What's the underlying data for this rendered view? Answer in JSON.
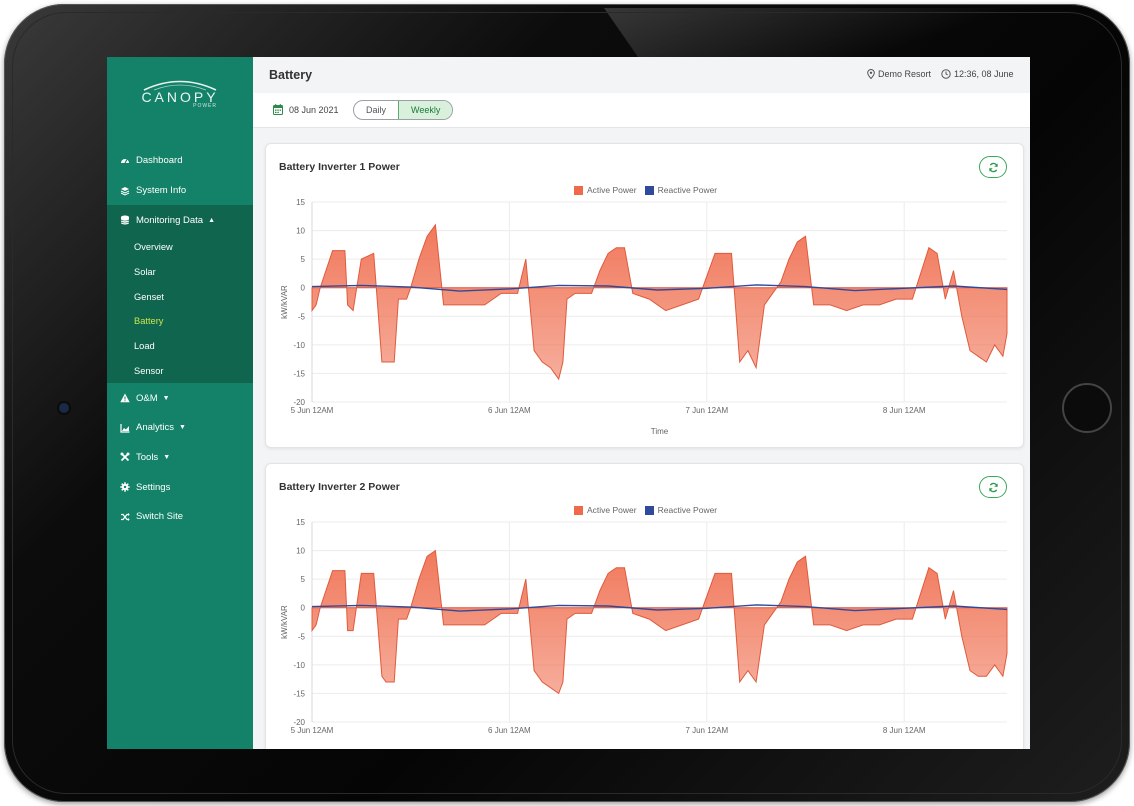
{
  "app": {
    "logo_text": "CANOPY",
    "logo_sub": "POWER",
    "page_title": "Battery",
    "site_name": "Demo Resort",
    "clock": "12:36, 08 June"
  },
  "sidebar": {
    "items": [
      {
        "label": "Dashboard",
        "icon": "gauge-icon"
      },
      {
        "label": "System Info",
        "icon": "layers-icon"
      },
      {
        "label": "Monitoring Data",
        "icon": "database-icon"
      },
      {
        "label": "O&M",
        "icon": "warning-icon"
      },
      {
        "label": "Analytics",
        "icon": "area-chart-icon"
      },
      {
        "label": "Tools",
        "icon": "tools-icon"
      },
      {
        "label": "Settings",
        "icon": "gear-icon"
      },
      {
        "label": "Switch Site",
        "icon": "shuffle-icon"
      }
    ],
    "monitoring_sub": [
      "Overview",
      "Solar",
      "Genset",
      "Battery",
      "Load",
      "Sensor"
    ],
    "active_sub": "Battery"
  },
  "filters": {
    "date": "08 Jun 2021",
    "modes": [
      "Daily",
      "Weekly"
    ],
    "selected_mode": "Weekly"
  },
  "colors": {
    "brand_green": "#138268",
    "active_power": "#ef6a4a",
    "reactive_power": "#2f4a9c",
    "active_nav": "#c9e44a"
  },
  "chart_data": [
    {
      "type": "area",
      "title": "Battery Inverter 1 Power",
      "xlabel": "Time",
      "ylabel": "kW/kVAR",
      "ylim": [
        -20,
        15
      ],
      "yticks": [
        15,
        10,
        5,
        0,
        -5,
        -10,
        -15,
        -20
      ],
      "xticks": [
        "5 Jun 12AM",
        "6 Jun 12AM",
        "7 Jun 12AM",
        "8 Jun 12AM"
      ],
      "legend_position": "top-center",
      "grid": true,
      "x_start": "2021-06-05T00:00",
      "x_end": "2021-06-08T12:30",
      "series": [
        {
          "name": "Active Power",
          "x": [
            "2021-06-05T00:00",
            "2021-06-05T00:30",
            "2021-06-05T01:00",
            "2021-06-05T02:30",
            "2021-06-05T04:00",
            "2021-06-05T04:20",
            "2021-06-05T05:00",
            "2021-06-05T06:00",
            "2021-06-05T07:30",
            "2021-06-05T08:30",
            "2021-06-05T09:00",
            "2021-06-05T09:30",
            "2021-06-05T10:00",
            "2021-06-05T10:30",
            "2021-06-05T11:30",
            "2021-06-05T12:00",
            "2021-06-05T13:00",
            "2021-06-05T14:00",
            "2021-06-05T15:00",
            "2021-06-05T16:00",
            "2021-06-05T17:00",
            "2021-06-05T18:00",
            "2021-06-05T19:30",
            "2021-06-05T21:00",
            "2021-06-05T23:00",
            "2021-06-06T01:00",
            "2021-06-06T02:00",
            "2021-06-06T03:00",
            "2021-06-06T04:00",
            "2021-06-06T05:00",
            "2021-06-06T06:00",
            "2021-06-06T06:30",
            "2021-06-06T07:00",
            "2021-06-06T08:00",
            "2021-06-06T09:00",
            "2021-06-06T10:00",
            "2021-06-06T11:00",
            "2021-06-06T12:00",
            "2021-06-06T13:00",
            "2021-06-06T14:00",
            "2021-06-06T15:00",
            "2021-06-06T17:00",
            "2021-06-06T19:00",
            "2021-06-06T21:00",
            "2021-06-06T23:00",
            "2021-06-07T01:00",
            "2021-06-07T03:00",
            "2021-06-07T04:00",
            "2021-06-07T05:00",
            "2021-06-07T06:00",
            "2021-06-07T07:00",
            "2021-06-07T08:00",
            "2021-06-07T09:00",
            "2021-06-07T10:00",
            "2021-06-07T11:00",
            "2021-06-07T12:00",
            "2021-06-07T13:00",
            "2021-06-07T14:00",
            "2021-06-07T15:00",
            "2021-06-07T17:00",
            "2021-06-07T19:00",
            "2021-06-07T21:00",
            "2021-06-07T23:00",
            "2021-06-08T01:00",
            "2021-06-08T03:00",
            "2021-06-08T04:00",
            "2021-06-08T05:00",
            "2021-06-08T06:00",
            "2021-06-08T07:00",
            "2021-06-08T08:00",
            "2021-06-08T09:00",
            "2021-06-08T10:00",
            "2021-06-08T11:00",
            "2021-06-08T12:00",
            "2021-06-08T12:30"
          ],
          "y": [
            -4,
            -3,
            0,
            6.5,
            6.5,
            -3,
            -4,
            5,
            6,
            -13,
            -13,
            -13,
            -13,
            -2,
            -2,
            0,
            5,
            9,
            11,
            -3,
            -3,
            -3,
            -3,
            -3,
            -1,
            -1,
            5,
            -11,
            -13,
            -14,
            -16,
            -13,
            -2,
            -1,
            -1,
            -1,
            3,
            6,
            7,
            7,
            -1,
            -2,
            -4,
            -3,
            -2,
            6,
            6,
            -13,
            -11,
            -14,
            -3,
            -1,
            1,
            5,
            8,
            9,
            -3,
            -3,
            -3,
            -4,
            -3,
            -3,
            -2,
            -2,
            7,
            6,
            -2,
            3,
            -5,
            -11,
            -12,
            -13,
            -10,
            -12,
            -8
          ]
        },
        {
          "name": "Reactive Power",
          "x": [
            "2021-06-05T00:00",
            "2021-06-05T06:00",
            "2021-06-05T12:00",
            "2021-06-05T18:00",
            "2021-06-06T00:00",
            "2021-06-06T06:00",
            "2021-06-06T12:00",
            "2021-06-06T18:00",
            "2021-06-07T00:00",
            "2021-06-07T06:00",
            "2021-06-07T12:00",
            "2021-06-07T18:00",
            "2021-06-08T00:00",
            "2021-06-08T06:00",
            "2021-06-08T12:30"
          ],
          "y": [
            0.2,
            0.4,
            0.1,
            -0.6,
            -0.2,
            0.4,
            0.3,
            -0.4,
            -0.1,
            0.5,
            0.2,
            -0.5,
            -0.1,
            0.3,
            -0.3
          ]
        }
      ]
    },
    {
      "type": "area",
      "title": "Battery Inverter 2 Power",
      "xlabel": "",
      "ylabel": "kW/kVAR",
      "ylim": [
        -20,
        15
      ],
      "yticks": [
        15,
        10,
        5,
        0,
        -5,
        -10,
        -15,
        -20
      ],
      "xticks": [
        "5 Jun 12AM",
        "6 Jun 12AM",
        "7 Jun 12AM",
        "8 Jun 12AM"
      ],
      "legend_position": "top-center",
      "grid": true,
      "x_start": "2021-06-05T00:00",
      "x_end": "2021-06-08T12:30",
      "series": [
        {
          "name": "Active Power",
          "x": [
            "2021-06-05T00:00",
            "2021-06-05T00:30",
            "2021-06-05T01:00",
            "2021-06-05T02:30",
            "2021-06-05T04:00",
            "2021-06-05T04:20",
            "2021-06-05T05:00",
            "2021-06-05T06:00",
            "2021-06-05T07:30",
            "2021-06-05T08:30",
            "2021-06-05T09:00",
            "2021-06-05T09:30",
            "2021-06-05T10:00",
            "2021-06-05T10:30",
            "2021-06-05T11:30",
            "2021-06-05T12:00",
            "2021-06-05T13:00",
            "2021-06-05T14:00",
            "2021-06-05T15:00",
            "2021-06-05T16:00",
            "2021-06-05T17:00",
            "2021-06-05T18:00",
            "2021-06-05T19:30",
            "2021-06-05T21:00",
            "2021-06-05T23:00",
            "2021-06-06T01:00",
            "2021-06-06T02:00",
            "2021-06-06T03:00",
            "2021-06-06T04:00",
            "2021-06-06T05:00",
            "2021-06-06T06:00",
            "2021-06-06T06:30",
            "2021-06-06T07:00",
            "2021-06-06T08:00",
            "2021-06-06T09:00",
            "2021-06-06T10:00",
            "2021-06-06T11:00",
            "2021-06-06T12:00",
            "2021-06-06T13:00",
            "2021-06-06T14:00",
            "2021-06-06T15:00",
            "2021-06-06T17:00",
            "2021-06-06T19:00",
            "2021-06-06T21:00",
            "2021-06-06T23:00",
            "2021-06-07T01:00",
            "2021-06-07T03:00",
            "2021-06-07T04:00",
            "2021-06-07T05:00",
            "2021-06-07T06:00",
            "2021-06-07T07:00",
            "2021-06-07T08:00",
            "2021-06-07T09:00",
            "2021-06-07T10:00",
            "2021-06-07T11:00",
            "2021-06-07T12:00",
            "2021-06-07T13:00",
            "2021-06-07T14:00",
            "2021-06-07T15:00",
            "2021-06-07T17:00",
            "2021-06-07T19:00",
            "2021-06-07T21:00",
            "2021-06-07T23:00",
            "2021-06-08T01:00",
            "2021-06-08T03:00",
            "2021-06-08T04:00",
            "2021-06-08T05:00",
            "2021-06-08T06:00",
            "2021-06-08T07:00",
            "2021-06-08T08:00",
            "2021-06-08T09:00",
            "2021-06-08T10:00",
            "2021-06-08T11:00",
            "2021-06-08T12:00",
            "2021-06-08T12:30"
          ],
          "y": [
            -4,
            -3,
            0,
            6.5,
            6.5,
            -4,
            -4,
            6,
            6,
            -12,
            -13,
            -13,
            -13,
            -2,
            -2,
            0,
            5,
            9,
            10,
            -3,
            -3,
            -3,
            -3,
            -3,
            -1,
            -1,
            5,
            -11,
            -13,
            -14,
            -15,
            -13,
            -2,
            -1,
            -1,
            -1,
            3,
            6,
            7,
            7,
            -1,
            -2,
            -4,
            -3,
            -2,
            6,
            6,
            -13,
            -11,
            -13,
            -3,
            -1,
            1,
            5,
            8,
            9,
            -3,
            -3,
            -3,
            -4,
            -3,
            -3,
            -2,
            -2,
            7,
            6,
            -2,
            3,
            -5,
            -11,
            -12,
            -12,
            -10,
            -12,
            -8
          ]
        },
        {
          "name": "Reactive Power",
          "x": [
            "2021-06-05T00:00",
            "2021-06-05T06:00",
            "2021-06-05T12:00",
            "2021-06-05T18:00",
            "2021-06-06T00:00",
            "2021-06-06T06:00",
            "2021-06-06T12:00",
            "2021-06-06T18:00",
            "2021-06-07T00:00",
            "2021-06-07T06:00",
            "2021-06-07T12:00",
            "2021-06-07T18:00",
            "2021-06-08T00:00",
            "2021-06-08T06:00",
            "2021-06-08T12:30"
          ],
          "y": [
            0.2,
            0.4,
            0.1,
            -0.6,
            -0.2,
            0.4,
            0.3,
            -0.4,
            -0.1,
            0.5,
            0.2,
            -0.5,
            -0.1,
            0.3,
            -0.3
          ]
        }
      ]
    }
  ]
}
